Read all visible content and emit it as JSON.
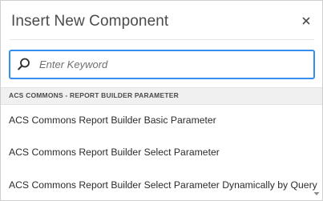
{
  "dialog": {
    "title": "Insert New Component",
    "close_icon": "close-icon"
  },
  "search": {
    "placeholder": "Enter Keyword",
    "value": "",
    "icon": "search-icon",
    "accent_color": "#378ef0"
  },
  "group": {
    "label": "ACS COMMONS - REPORT BUILDER PARAMETER"
  },
  "components": [
    {
      "label": "ACS Commons Report Builder Basic Parameter"
    },
    {
      "label": "ACS Commons Report Builder Select Parameter"
    },
    {
      "label": "ACS Commons Report Builder Select Parameter Dynamically by Query"
    }
  ],
  "scroll_icon": "chevron-down-icon"
}
